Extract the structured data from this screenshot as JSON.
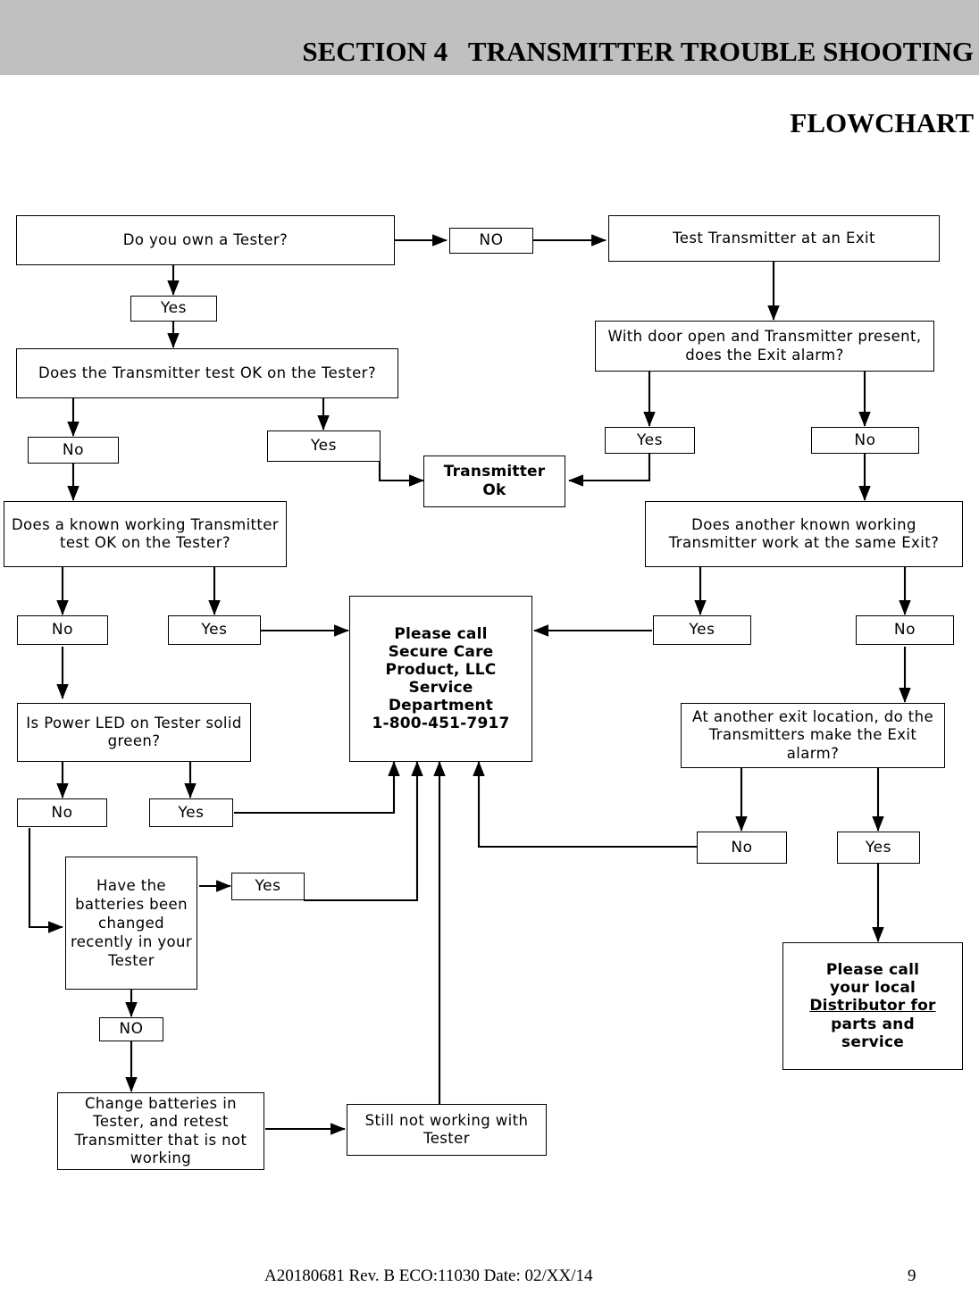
{
  "header": {
    "title_line1": "SECTION 4   TRANSMITTER TROUBLE SHOOTING",
    "title_line2": "FLOWCHART",
    "background": "#c0c0c0"
  },
  "footer": {
    "document_code": "A20180681 Rev. B  ECO:11030 Date: 02/XX/14",
    "page_number": "9"
  },
  "flowchart": {
    "nodes": {
      "own_tester": "Do you own a Tester?",
      "yes_own_tester": "Yes",
      "no_own_tester": "NO",
      "test_at_exit": "Test Transmitter at an Exit",
      "door_open_alarm": "With door open and Transmitter present, does the Exit alarm?",
      "yes_door_alarm": "Yes",
      "no_door_alarm": "No",
      "transmitter_test_ok": "Does the Transmitter test OK on the Tester?",
      "no_test_ok": "No",
      "yes_test_ok": "Yes",
      "transmitter_ok_line1": "Transmitter",
      "transmitter_ok_line2": "Ok",
      "known_working_tester": "Does a known working Transmitter test OK on the Tester?",
      "no_known_working": "No",
      "yes_known_working": "Yes",
      "another_known_working": "Does another known working Transmitter work at the same Exit?",
      "yes_another_working": "Yes",
      "no_another_working": "No",
      "call_secure_care_line1": "Please call",
      "call_secure_care_line2": "Secure Care",
      "call_secure_care_line3": "Product, LLC",
      "call_secure_care_line4": "Service",
      "call_secure_care_line5": "Department",
      "call_secure_care_phone": "1-800-451-7917",
      "power_led": "Is Power LED on Tester solid green?",
      "no_power_led": "No",
      "yes_power_led": "Yes",
      "another_exit_location": "At another exit location, do the Transmitters make the Exit alarm?",
      "no_another_exit": "No",
      "yes_another_exit": "Yes",
      "batteries_changed": "Have the batteries been changed recently in your Tester",
      "yes_batteries": "Yes",
      "no_batteries": "NO",
      "change_batteries": "Change batteries in Tester, and retest Transmitter that is not working",
      "still_not_working": "Still not working with Tester",
      "call_distributor_line1": "Please call",
      "call_distributor_line2": "your local",
      "call_distributor_line3a": "Distributor",
      "call_distributor_line3b": " for",
      "call_distributor_line4": "parts and",
      "call_distributor_line5": "service"
    }
  }
}
